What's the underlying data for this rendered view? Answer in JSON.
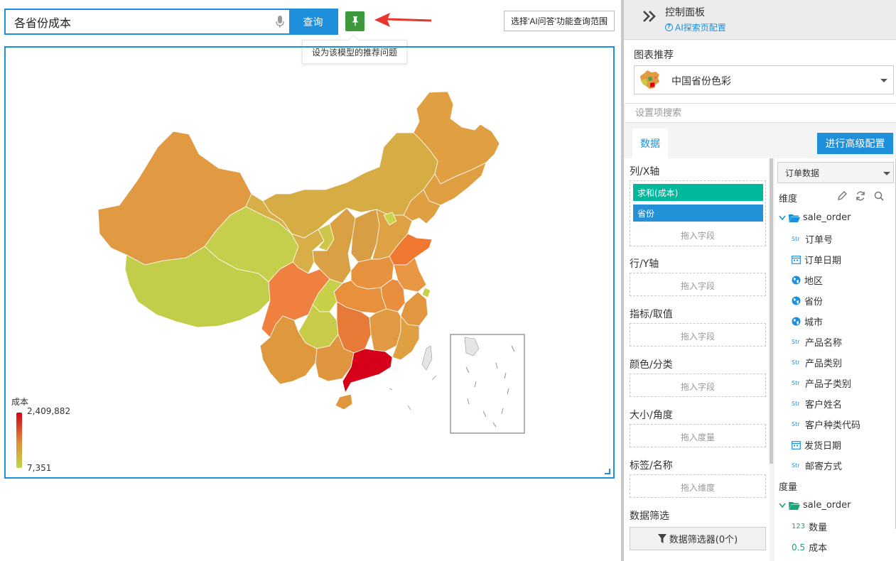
{
  "query": {
    "value": "各省份成本",
    "submit_label": "查询",
    "pin_tooltip": "设为该模型的推荐问题",
    "scope_button": "选择'AI问答'功能查询范围"
  },
  "chart_data": {
    "type": "heatmap",
    "subtype": "china-province-choropleth",
    "measure": "成本",
    "legend": {
      "title": "成本",
      "max": 2409882,
      "min": 7351,
      "max_label": "2,409,882",
      "min_label": "7,351",
      "placement": "bottom-left"
    },
    "color_low": "#c2d64a",
    "color_mid": "#e0903a",
    "color_high": "#d7001a",
    "inset_map": true
  },
  "panel": {
    "title": "控制面板",
    "config_link": "AI探索页配置",
    "chart_rec_label": "图表推荐",
    "chart_rec_value": "中国省份色彩",
    "search_placeholder": "设置项搜索",
    "tab_data": "数据",
    "advanced_button": "进行高级配置",
    "fields": {
      "x_axis": {
        "label": "列/X轴",
        "chips": [
          {
            "text": "求和(成本)",
            "color": "#00b89c"
          },
          {
            "text": "省份",
            "color": "#2391d8"
          }
        ],
        "hint": "拖入字段"
      },
      "y_axis": {
        "label": "行/Y轴",
        "hint": "拖入字段"
      },
      "metric": {
        "label": "指标/取值",
        "hint": "拖入字段"
      },
      "color": {
        "label": "颜色/分类",
        "hint": "拖入字段"
      },
      "size": {
        "label": "大小/角度",
        "hint": "拖入度量"
      },
      "tag": {
        "label": "标签/名称",
        "hint": "拖入维度"
      },
      "filter": {
        "label": "数据筛选",
        "button": "数据筛选器(0个)"
      }
    },
    "source_select": "订单数据",
    "dimensions_title": "维度",
    "dimensions_folder": "sale_order",
    "dimensions": [
      {
        "type": "str",
        "name": "订单号"
      },
      {
        "type": "date",
        "name": "订单日期"
      },
      {
        "type": "geo",
        "name": "地区"
      },
      {
        "type": "geo",
        "name": "省份"
      },
      {
        "type": "geo",
        "name": "城市"
      },
      {
        "type": "str",
        "name": "产品名称"
      },
      {
        "type": "str",
        "name": "产品类别"
      },
      {
        "type": "str",
        "name": "产品子类别"
      },
      {
        "type": "str",
        "name": "客户姓名"
      },
      {
        "type": "str",
        "name": "客户种类代码"
      },
      {
        "type": "date",
        "name": "发货日期"
      },
      {
        "type": "str",
        "name": "邮寄方式"
      }
    ],
    "measures_title": "度量",
    "measures_folder": "sale_order",
    "measures": [
      {
        "type": "123",
        "name": "数量"
      },
      {
        "type": "0.5",
        "name": "成本"
      }
    ]
  }
}
